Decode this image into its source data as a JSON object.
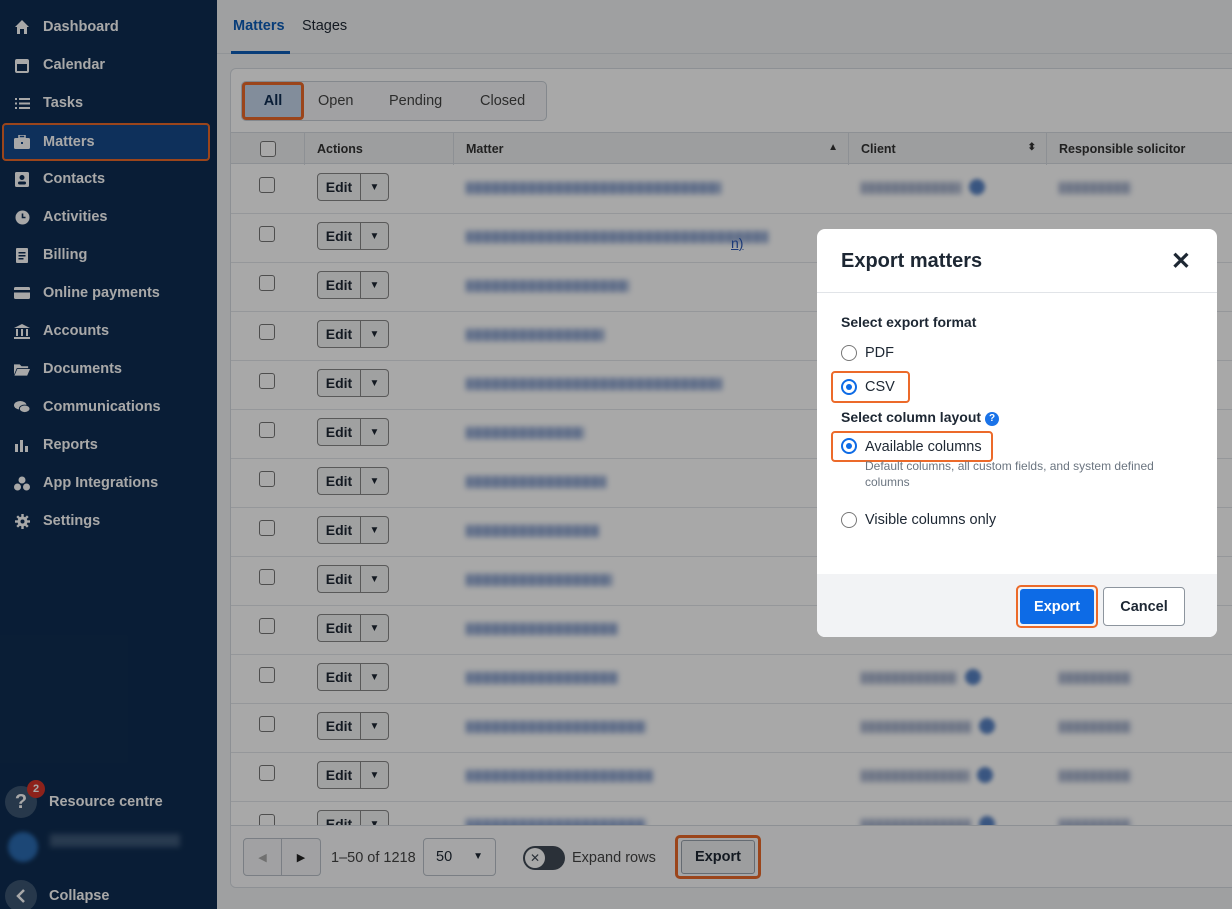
{
  "sidebar": {
    "items": [
      {
        "label": "Dashboard",
        "icon": "home-icon"
      },
      {
        "label": "Calendar",
        "icon": "calendar-icon"
      },
      {
        "label": "Tasks",
        "icon": "list-icon"
      },
      {
        "label": "Matters",
        "icon": "briefcase-icon"
      },
      {
        "label": "Contacts",
        "icon": "contacts-icon"
      },
      {
        "label": "Activities",
        "icon": "clock-icon"
      },
      {
        "label": "Billing",
        "icon": "invoice-icon"
      },
      {
        "label": "Online payments",
        "icon": "card-icon"
      },
      {
        "label": "Accounts",
        "icon": "bank-icon"
      },
      {
        "label": "Documents",
        "icon": "folder-icon"
      },
      {
        "label": "Communications",
        "icon": "chat-icon"
      },
      {
        "label": "Reports",
        "icon": "bar-chart-icon"
      },
      {
        "label": "App Integrations",
        "icon": "integrations-icon"
      },
      {
        "label": "Settings",
        "icon": "gear-icon"
      }
    ],
    "active_item": "Matters",
    "resource_centre": {
      "label": "Resource centre",
      "badge": "2"
    },
    "collapse_label": "Collapse"
  },
  "tabs": {
    "matters": "Matters",
    "stages": "Stages"
  },
  "filters": {
    "all": "All",
    "open": "Open",
    "pending": "Pending",
    "closed": "Closed"
  },
  "table": {
    "columns": {
      "actions": "Actions",
      "matter": "Matter",
      "client": "Client",
      "responsible": "Responsible solicitor"
    },
    "edit_label": "Edit",
    "visible_fragment": "n)"
  },
  "footer": {
    "range": "1–50 of 1218",
    "per_page": "50",
    "expand_rows": "Expand rows",
    "export": "Export"
  },
  "modal": {
    "title": "Export matters",
    "format_label": "Select export format",
    "formats": {
      "pdf": "PDF",
      "csv": "CSV"
    },
    "selected_format": "CSV",
    "layout_label": "Select column layout",
    "layouts": {
      "available": "Available columns",
      "available_hint": "Default columns, all custom fields, and system defined columns",
      "visible": "Visible columns only"
    },
    "selected_layout": "Available columns",
    "export_button": "Export",
    "cancel_button": "Cancel"
  },
  "colors": {
    "sidebar": "#0f2d52",
    "accent": "#0d6be6",
    "highlight": "#ec6a2a"
  }
}
